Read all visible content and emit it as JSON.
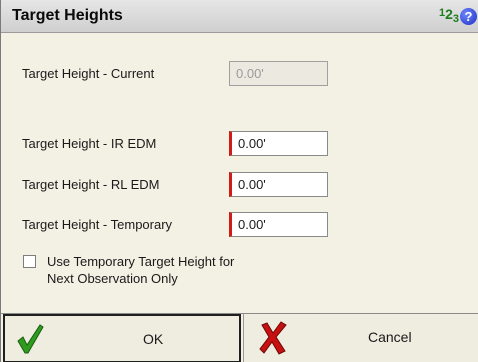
{
  "window": {
    "title": "Target Heights",
    "numeric_icon": {
      "d1": "1",
      "d2": "2",
      "d3": "3"
    },
    "help_icon": "?"
  },
  "fields": {
    "current": {
      "label": "Target Height - Current",
      "value": "0.00'"
    },
    "ir_edm": {
      "label": "Target Height - IR EDM",
      "value": "0.00'"
    },
    "rl_edm": {
      "label": "Target Height - RL EDM",
      "value": "0.00'"
    },
    "temporary": {
      "label": "Target Height - Temporary",
      "value": "0.00'"
    }
  },
  "option": {
    "line1": "Use Temporary Target Height for",
    "line2": "Next Observation Only",
    "checked": false
  },
  "buttons": {
    "ok_label": "OK",
    "cancel_label": "Cancel"
  },
  "colors": {
    "background": "#f3f0e4",
    "accent_required": "#d11a1a",
    "ok_check": "#2e9b1e",
    "cancel_x": "#c81010"
  }
}
